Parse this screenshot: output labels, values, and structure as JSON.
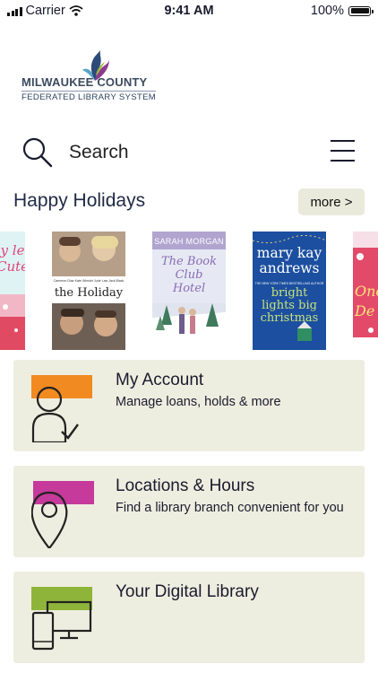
{
  "status_bar": {
    "carrier": "Carrier",
    "time": "9:41 AM",
    "battery": "100%"
  },
  "logo": {
    "line1": "MILWAUKEE COUNTY",
    "line2": "FEDERATED LIBRARY SYSTEM"
  },
  "search": {
    "label": "Search"
  },
  "section": {
    "title": "Happy Holidays",
    "more_label": "more >"
  },
  "books": [
    {
      "title_partial": "y le Cute",
      "color": "#dff3f4"
    },
    {
      "title": "the Holiday",
      "credits": "Cameron Diaz  Kate Winslet  Jude Law  Jack Black",
      "color": "#c9c2b8"
    },
    {
      "author": "SARAH MORGAN",
      "title": "The Book Club Hotel",
      "color": "#dfe4ef"
    },
    {
      "author": "mary kay andrews",
      "title": "bright lights big christmas",
      "tagline": "THE NEW YORK TIMES BESTSELLING AUTHOR",
      "color": "#1c4fa0"
    },
    {
      "title_partial": "Onc De",
      "color": "#e34a6a"
    }
  ],
  "cards": [
    {
      "title": "My Account",
      "subtitle": "Manage loans, holds & more",
      "accent": "#f28a22",
      "icon": "account-icon"
    },
    {
      "title": "Locations & Hours",
      "subtitle": "Find a library branch convenient for you",
      "accent": "#c53a9a",
      "icon": "location-pin-icon"
    },
    {
      "title": "Your Digital Library",
      "subtitle": "",
      "accent": "#8fb43a",
      "icon": "devices-icon"
    }
  ]
}
